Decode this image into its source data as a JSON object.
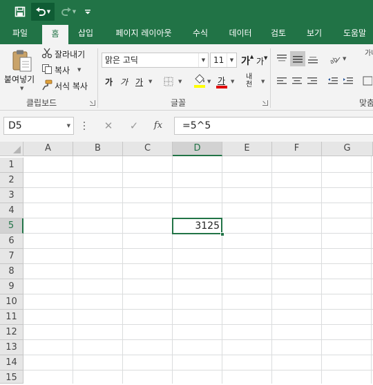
{
  "qat": {
    "save": "save-icon",
    "undo": "undo-icon",
    "redo": "redo-icon",
    "customize": "customize-icon"
  },
  "tabs": [
    {
      "label": "파일"
    },
    {
      "label": "홈"
    },
    {
      "label": "삽입"
    },
    {
      "label": "페이지 레이아웃"
    },
    {
      "label": "수식"
    },
    {
      "label": "데이터"
    },
    {
      "label": "검토"
    },
    {
      "label": "보기"
    },
    {
      "label": "도움말"
    }
  ],
  "active_tab": "홈",
  "ribbon": {
    "clipboard": {
      "paste_label": "붙여넣기",
      "cut_label": "잘라내기",
      "copy_label": "복사",
      "format_painter_label": "서식 복사",
      "group_label": "클립보드"
    },
    "font": {
      "font_name": "맑은 고딕",
      "font_size": "11",
      "grow_glyph": "가",
      "shrink_glyph": "가",
      "bold_glyph": "가",
      "italic_glyph": "가",
      "underline_glyph": "가",
      "font_color_glyph": "가",
      "phonetic_glyph": "내천",
      "group_label": "글꼴"
    },
    "alignment": {
      "group_label": "맞춤",
      "wrap_glyph": "가나"
    }
  },
  "formula_bar": {
    "name_box": "D5",
    "formula": "=5^5",
    "fx_label": "fx"
  },
  "sheet": {
    "columns": [
      "A",
      "B",
      "C",
      "D",
      "E",
      "F",
      "G"
    ],
    "rows": [
      "1",
      "2",
      "3",
      "4",
      "5",
      "6",
      "7",
      "8",
      "9",
      "10",
      "11",
      "12",
      "13",
      "14",
      "15"
    ],
    "selected_column": "D",
    "selected_row": "5",
    "active_cell_value": "3125"
  },
  "colors": {
    "accent": "#217346",
    "ribbon_bg": "#f3f3f3",
    "header_bg": "#e6e6e6"
  }
}
